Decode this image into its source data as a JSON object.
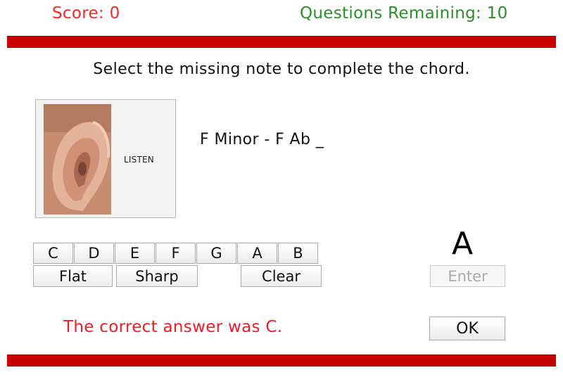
{
  "header": {
    "score": "Score: 0",
    "questions_remaining": "Questions Remaining: 10"
  },
  "instruction": "Select the missing note to complete the chord.",
  "listen": {
    "label": "LISTEN",
    "image": "ear-photo"
  },
  "question": "F Minor - F Ab _",
  "notes": [
    "C",
    "D",
    "E",
    "F",
    "G",
    "A",
    "B"
  ],
  "modifiers": {
    "flat": "Flat",
    "sharp": "Sharp",
    "clear": "Clear"
  },
  "selected_note": "A",
  "enter_label": "Enter",
  "feedback": "The correct answer was C.",
  "ok_label": "OK",
  "colors": {
    "bar": "#c90000",
    "score": "#ee2a2a",
    "remaining": "#2e8b2e",
    "feedback": "#ee1d2a"
  }
}
